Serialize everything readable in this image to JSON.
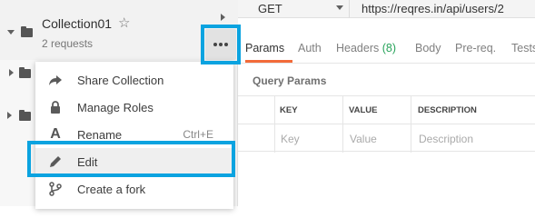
{
  "collection": {
    "name": "Collection01",
    "count": "2 requests",
    "star_icon": "star-outline-icon"
  },
  "menu": {
    "items": [
      {
        "label": "Share Collection",
        "icon": "share-arrow-icon",
        "shortcut": ""
      },
      {
        "label": "Manage Roles",
        "icon": "lock-icon",
        "shortcut": ""
      },
      {
        "label": "Rename",
        "icon": "rename-icon",
        "shortcut": "Ctrl+E"
      },
      {
        "label": "Edit",
        "icon": "pencil-icon",
        "shortcut": ""
      },
      {
        "label": "Create a fork",
        "icon": "fork-icon",
        "shortcut": ""
      }
    ]
  },
  "request": {
    "method": "GET",
    "url": "https://reqres.in/api/users/2"
  },
  "tabs": [
    {
      "label": "Params"
    },
    {
      "label": "Auth"
    },
    {
      "label": "Headers",
      "count": "(8)"
    },
    {
      "label": "Body"
    },
    {
      "label": "Pre-req."
    },
    {
      "label": "Tests"
    }
  ],
  "query_params": {
    "title": "Query Params",
    "headers": [
      "KEY",
      "VALUE",
      "DESCRIPTION"
    ],
    "placeholders": [
      "Key",
      "Value",
      "Description"
    ]
  },
  "colors": {
    "highlight": "#0ba3e0",
    "active_tab": "#f26b3a",
    "headers_count": "#27a35a"
  }
}
